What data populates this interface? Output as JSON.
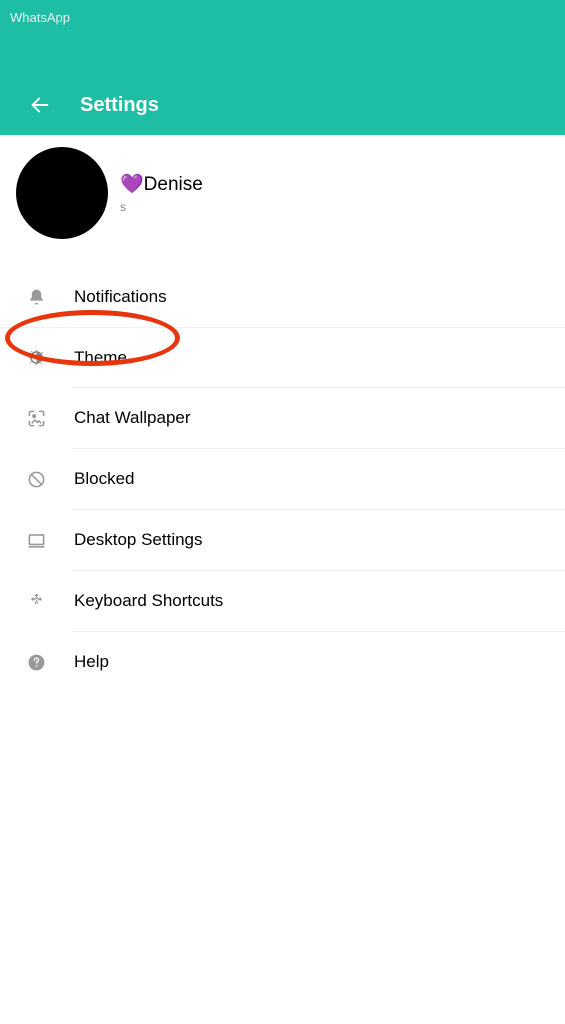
{
  "app_name": "WhatsApp",
  "header": {
    "title": "Settings"
  },
  "profile": {
    "name": "💜Denise",
    "sub": "s"
  },
  "menu": {
    "notifications": "Notifications",
    "theme": "Theme",
    "chat_wallpaper": "Chat Wallpaper",
    "blocked": "Blocked",
    "desktop_settings": "Desktop Settings",
    "keyboard_shortcuts": "Keyboard Shortcuts",
    "help": "Help"
  }
}
